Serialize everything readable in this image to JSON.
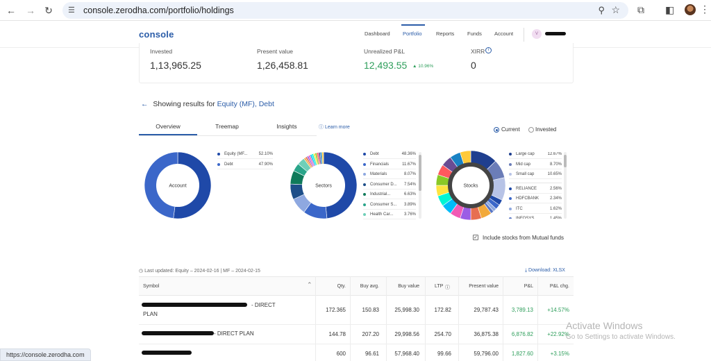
{
  "browser": {
    "url": "console.zerodha.com/portfolio/holdings",
    "status_url": "https://console.zerodha.com"
  },
  "header": {
    "logo": "console",
    "nav": [
      "Dashboard",
      "Portfolio",
      "Reports",
      "Funds",
      "Account"
    ],
    "active_nav": "Portfolio",
    "avatar_initial": "V"
  },
  "summary": {
    "invested_label": "Invested",
    "invested_value": "1,13,965.25",
    "present_label": "Present value",
    "present_value": "1,26,458.81",
    "pnl_label": "Unrealized P&L",
    "pnl_value": "12,493.55",
    "pnl_pct": "▲ 10.96%",
    "xirr_label": "XIRR",
    "xirr_value": "0"
  },
  "filter": {
    "prefix": "Showing results for",
    "value": "Equity (MF), Debt"
  },
  "tabs": [
    "Overview",
    "Treemap",
    "Insights"
  ],
  "learn_more": "Learn more",
  "view_toggle": {
    "current": "Current",
    "invested": "Invested",
    "selected": "Current"
  },
  "chart_data": [
    {
      "type": "pie",
      "center_label": "Account",
      "labels": [
        "Equity (MF...",
        "Debt"
      ],
      "values": [
        52.1,
        47.9
      ],
      "value_labels": [
        "52.10%",
        "47.90%"
      ],
      "colors": [
        "#1f49a8",
        "#3b67c9"
      ]
    },
    {
      "type": "pie",
      "center_label": "Sectors",
      "labels": [
        "Debt",
        "Financials",
        "Materials",
        "Consumer D...",
        "Industrial...",
        "Consumer S...",
        "Health Car..."
      ],
      "values": [
        48.36,
        11.67,
        8.07,
        7.54,
        6.63,
        3.89,
        3.76
      ],
      "value_labels": [
        "48.36%",
        "11.67%",
        "8.07%",
        "7.54%",
        "6.63%",
        "3.89%",
        "3.76%"
      ],
      "colors": [
        "#1f49a8",
        "#3b67c9",
        "#8ea8e0",
        "#1d4e89",
        "#0f7a5a",
        "#2aa58a",
        "#6fcfb8"
      ]
    },
    {
      "type": "pie",
      "center_label": "Stocks",
      "labels": [
        "Large cap",
        "Mid cap",
        "Small cap",
        "RELIANCE",
        "HDFCBANK",
        "ITC",
        "INFOSYS"
      ],
      "values": [
        12.67,
        8.7,
        10.65,
        2.56,
        2.34,
        1.62,
        1.45
      ],
      "value_labels": [
        "12.67%",
        "8.70%",
        "10.65%",
        "2.56%",
        "2.34%",
        "1.62%",
        "1.45%"
      ],
      "colors": [
        "#1f3f8f",
        "#6b7db8",
        "#b7c3e6",
        "#1f49a8",
        "#3b67c9",
        "#8ea8e0",
        "#5a77c4"
      ]
    }
  ],
  "include_mf": "Include stocks from Mutual funds",
  "last_updated": "Last updated: Equity – 2024-02-16 | MF – 2024-02-15",
  "download": "Download: XLSX",
  "table": {
    "columns": [
      "Symbol",
      "Qty.",
      "Buy avg.",
      "Buy value",
      "LTP",
      "Present value",
      "P&L",
      "P&L chg."
    ],
    "rows": [
      {
        "symbol_suffix": "- DIRECT",
        "symbol_line2": "PLAN",
        "qty": "172.365",
        "avg": "150.83",
        "buy_value": "25,998.30",
        "ltp": "172.82",
        "present": "29,787.43",
        "pnl": "3,789.13",
        "chg": "+14.57%"
      },
      {
        "symbol_suffix": "- DIRECT PLAN",
        "symbol_line2": "",
        "qty": "144.78",
        "avg": "207.20",
        "buy_value": "29,998.56",
        "ltp": "254.70",
        "present": "36,875.38",
        "pnl": "6,876.82",
        "chg": "+22.92%"
      },
      {
        "symbol_suffix": "",
        "symbol_line2": "",
        "qty": "600",
        "avg": "96.61",
        "buy_value": "57,968.40",
        "ltp": "99.66",
        "present": "59,796.00",
        "pnl": "1,827.60",
        "chg": "+3.15%"
      }
    ]
  },
  "watermark": {
    "line1": "Activate Windows",
    "line2": "Go to Settings to activate Windows."
  }
}
